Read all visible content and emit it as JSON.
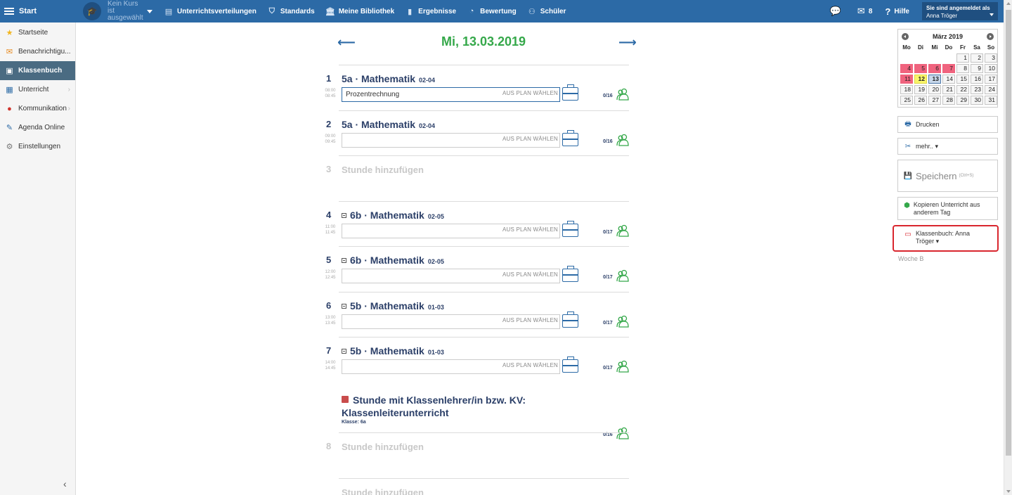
{
  "topbar": {
    "start_label": "Start",
    "course_label": "Kein Kurs ist ausgewählt",
    "nav": [
      {
        "label": "Unterrichtsverteilungen",
        "icon": "table-icon"
      },
      {
        "label": "Standards",
        "icon": "shield-icon"
      },
      {
        "label": "Meine Bibliothek",
        "icon": "library-icon"
      },
      {
        "label": "Ergebnisse",
        "icon": "bar-chart-icon"
      },
      {
        "label": "Bewertung",
        "icon": "gauge-icon"
      },
      {
        "label": "Schüler",
        "icon": "students-icon"
      }
    ],
    "messages_count": "8",
    "help_label": "Hilfe",
    "user_line1": "Sie sind angemeldet als",
    "user_name": "Anna Tröger"
  },
  "sidebar": {
    "items": [
      {
        "label": "Startseite",
        "icon": "star-icon"
      },
      {
        "label": "Benachrichtigu...",
        "icon": "envelope-icon"
      },
      {
        "label": "Klassenbuch",
        "icon": "book-icon"
      },
      {
        "label": "Unterricht",
        "icon": "briefcase-icon"
      },
      {
        "label": "Kommunikation",
        "icon": "chat-icon"
      },
      {
        "label": "Agenda Online",
        "icon": "pen-icon"
      },
      {
        "label": "Einstellungen",
        "icon": "gear-icon"
      }
    ]
  },
  "main": {
    "date": "Mi, 13.03.2019",
    "plan_label": "AUS PLAN WÄHLEN",
    "add_label": "Stunde hinzufügen",
    "lessons": [
      {
        "num": "1",
        "start": "08:00",
        "end": "08:45",
        "title": "5a · Mathematik",
        "room": "02-04",
        "topic": "Prozentrechnung",
        "count": "0/16"
      },
      {
        "num": "2",
        "start": "09:00",
        "end": "09:45",
        "title": "5a · Mathematik",
        "room": "02-04",
        "topic": "",
        "count": "0/16"
      },
      {
        "num": "3"
      },
      {
        "num": "4",
        "start": "11:00",
        "end": "11:45",
        "title": "6b · Mathematik",
        "room": "02-05",
        "topic": "",
        "count": "0/17"
      },
      {
        "num": "5",
        "start": "12:00",
        "end": "12:45",
        "title": "6b · Mathematik",
        "room": "02-05",
        "topic": "",
        "count": "0/17"
      },
      {
        "num": "6",
        "start": "13:00",
        "end": "13:45",
        "title": "5b · Mathematik",
        "room": "01-03",
        "topic": "",
        "count": "0/17"
      },
      {
        "num": "7",
        "start": "14:00",
        "end": "14:45",
        "title": "5b · Mathematik",
        "room": "01-03",
        "topic": "",
        "count": "0/17"
      },
      {
        "num": "8"
      }
    ],
    "kv": {
      "title": "Stunde mit Klassenlehrer/in bzw. KV: Klassenleiterunterricht",
      "class_label": "Klasse:",
      "class_value": "6a",
      "count": "0/16"
    }
  },
  "calendar": {
    "month": "März 2019",
    "weekdays": [
      "Mo",
      "Di",
      "Mi",
      "Do",
      "Fr",
      "Sa",
      "So"
    ],
    "days": [
      "1",
      "2",
      "3",
      "4",
      "5",
      "6",
      "7",
      "8",
      "9",
      "10",
      "11",
      "12",
      "13",
      "14",
      "15",
      "16",
      "17",
      "18",
      "19",
      "20",
      "21",
      "22",
      "23",
      "24",
      "25",
      "26",
      "27",
      "28",
      "29",
      "30",
      "31"
    ]
  },
  "right": {
    "print": "Drucken",
    "more": "mehr.. ▾",
    "save": "Speichern",
    "save_shortcut": "(Ctrl+S)",
    "copy": "Kopieren Unterricht aus anderem Tag",
    "kb_line1": "Klassenbuch: Anna",
    "kb_line2": "Tröger ▾",
    "week": "Woche B"
  }
}
